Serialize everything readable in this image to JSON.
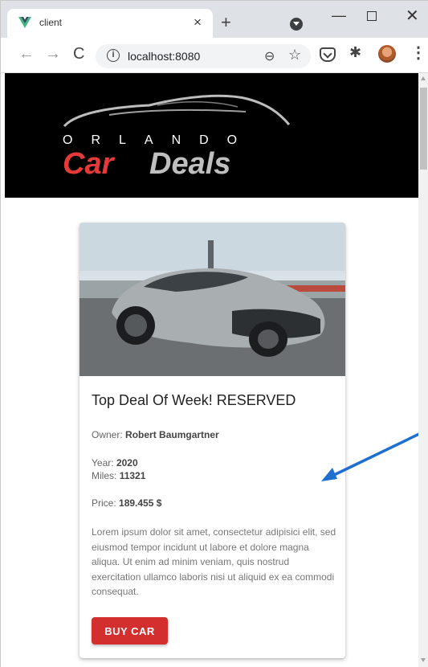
{
  "browser": {
    "tab_title": "client",
    "tab_close": "×",
    "new_tab": "+",
    "url": "localhost:8080",
    "info_symbol": "i",
    "minimize": "—",
    "close": "✕",
    "back": "←",
    "forward": "→",
    "reload": "C",
    "zoom": "⊖",
    "star": "☆",
    "puzzle": "✱",
    "menu": "⋮"
  },
  "logo": {
    "line1": "ORLANDO",
    "word_car": "Car",
    "word_deals": "Deals"
  },
  "card": {
    "title": "Top Deal Of Week! RESERVED",
    "owner_label": "Owner:",
    "owner": "Robert Baumgartner",
    "year_label": "Year:",
    "year": "2020",
    "miles_label": "Miles:",
    "miles": "11321",
    "price_label": "Price:",
    "price": "189.455 $",
    "description": "Lorem ipsum dolor sit amet, consectetur adipisici elit, sed eiusmod tempor incidunt ut labore et dolore magna aliqua. Ut enim ad minim veniam, quis nostrud exercitation ullamco laboris nisi ut aliquid ex ea commodi consequat.",
    "button": "BUY CAR"
  },
  "colors": {
    "accent": "#d32f2f",
    "annotation_arrow": "#1f6fd1",
    "vue_green": "#41b883"
  }
}
